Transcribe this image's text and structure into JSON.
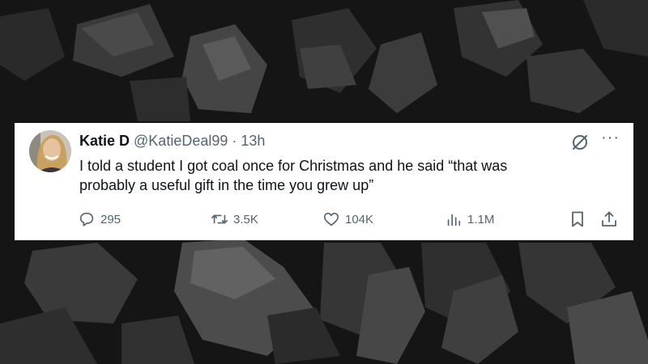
{
  "tweet": {
    "author_name": "Katie D",
    "handle": "@KatieDeal99",
    "separator": "·",
    "time": "13h",
    "text": "I told a student I got coal once for Christmas and he said “that was\nprobably a useful gift in the time you grew up”",
    "more_label": "···"
  },
  "stats": {
    "replies": "295",
    "reposts": "3.5K",
    "likes": "104K",
    "views": "1.1M"
  },
  "icons": {
    "reply": "reply-icon",
    "repost": "repost-icon",
    "like": "heart-icon",
    "views": "views-icon",
    "bookmark": "bookmark-icon",
    "share": "share-icon",
    "grok": "grok-icon",
    "more": "more-icon"
  },
  "colors": {
    "text": "#0f1419",
    "secondary": "#536471",
    "card": "#ffffff",
    "background": "#141414"
  }
}
